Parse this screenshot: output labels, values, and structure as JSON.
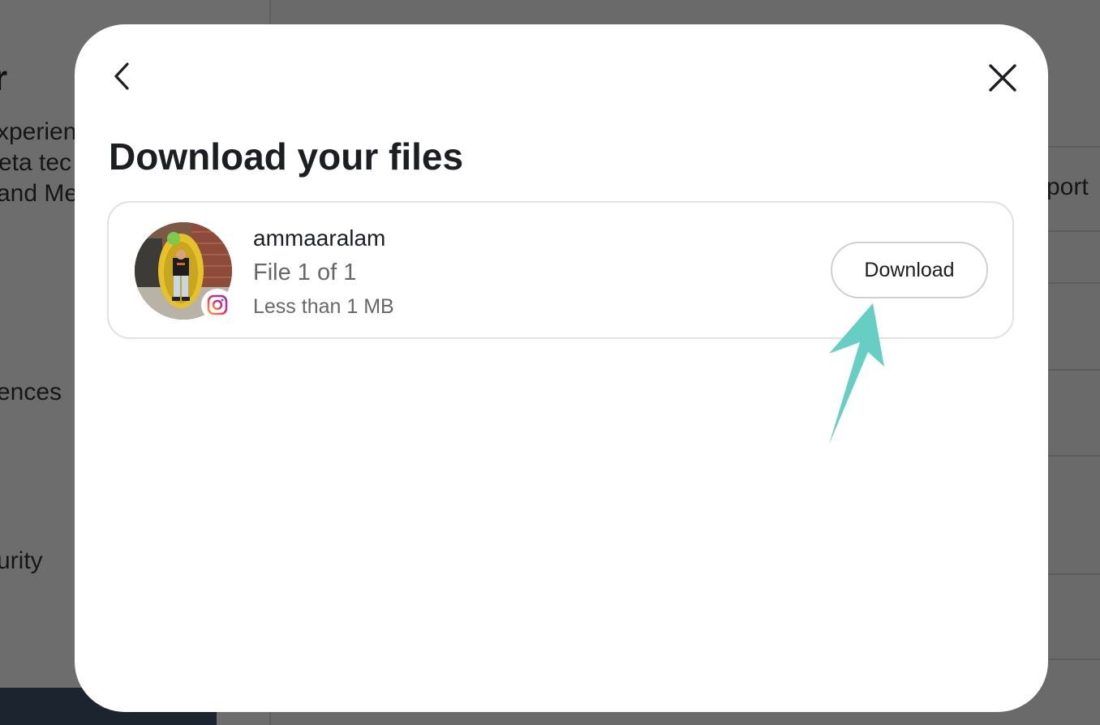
{
  "background": {
    "heading_fragment": "r",
    "text_lines": [
      "xperien",
      "eta tec",
      "and Me"
    ],
    "nav_fragments": [
      "ences",
      "urity"
    ],
    "right_fragment": "port",
    "bottom_fragment": "",
    "dark_fragment": ""
  },
  "modal": {
    "back_icon": "chevron-left-icon",
    "close_icon": "close-icon",
    "title": "Download your files",
    "file": {
      "account_name": "ammaaralam",
      "file_count": "File 1 of 1",
      "file_size": "Less than 1 MB",
      "platform_icon": "instagram-icon",
      "download_label": "Download"
    }
  },
  "annotation": {
    "arrow_color": "#66cec3"
  },
  "colors": {
    "overlay": "#6b6b6b",
    "modal_bg": "#ffffff",
    "title_text": "#1c1e21",
    "secondary_text": "#65676b",
    "border": "#dfe1e4"
  }
}
